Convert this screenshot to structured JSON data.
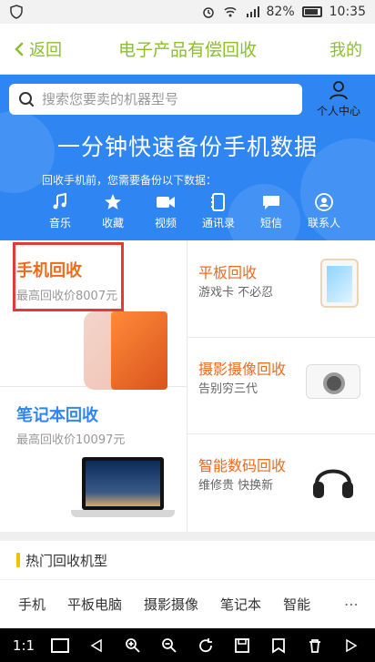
{
  "status_bar": {
    "battery": "82%",
    "time": "10:35"
  },
  "nav": {
    "back_label": "返回",
    "title": "电子产品有偿回收",
    "mine_label": "我的"
  },
  "search": {
    "placeholder": "搜索您要卖的机器型号"
  },
  "user_center": {
    "label": "个人中心"
  },
  "hero": {
    "title": "一分钟快速备份手机数据",
    "subtitle": "回收手机前，您需要备份以下数据：",
    "items": [
      {
        "label": "音乐",
        "icon": "music-icon"
      },
      {
        "label": "收藏",
        "icon": "star-icon"
      },
      {
        "label": "视频",
        "icon": "video-icon"
      },
      {
        "label": "通讯录",
        "icon": "contacts-icon"
      },
      {
        "label": "短信",
        "icon": "message-icon"
      },
      {
        "label": "联系人",
        "icon": "user-icon"
      }
    ],
    "colors": {
      "bg": "#2f86f2"
    }
  },
  "cards": {
    "phone": {
      "title": "手机回收",
      "subtitle": "最高回收价8007元"
    },
    "laptop": {
      "title": "笔记本回收",
      "subtitle": "最高回收价10097元"
    },
    "tablet": {
      "title": "平板回收",
      "subtitle": "游戏卡 不必忍"
    },
    "camera": {
      "title": "摄影摄像回收",
      "subtitle": "告别穷三代"
    },
    "digital": {
      "title": "智能数码回收",
      "subtitle": "维修贵 快换新"
    }
  },
  "hot_models": {
    "title": "热门回收机型",
    "tabs": [
      "手机",
      "平板电脑",
      "摄影摄像",
      "笔记本",
      "智能"
    ],
    "more": "⋯"
  },
  "toolbar": {
    "zoom_label": "1:1"
  }
}
